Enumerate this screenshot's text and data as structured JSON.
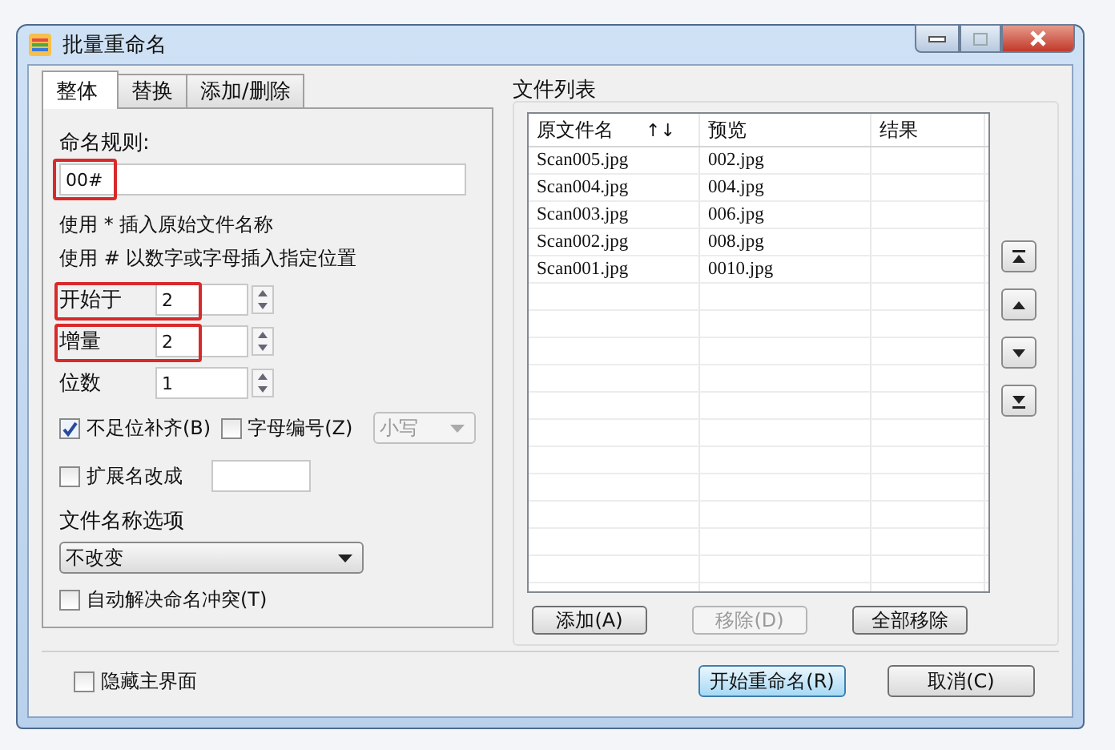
{
  "window": {
    "title": "批量重命名"
  },
  "tabs": [
    {
      "label": "整体",
      "selected": true
    },
    {
      "label": "替换",
      "selected": false
    },
    {
      "label": "添加/删除",
      "selected": false
    }
  ],
  "rule": {
    "label": "命名规则:",
    "value": "00#"
  },
  "hints": [
    "使用 * 插入原始文件名称",
    "使用 # 以数字或字母插入指定位置"
  ],
  "spinners": [
    {
      "label": "开始于",
      "value": "2",
      "highlighted": true
    },
    {
      "label": "增量",
      "value": "2",
      "highlighted": true
    },
    {
      "label": "位数",
      "value": "1",
      "highlighted": false
    }
  ],
  "pad": {
    "label": "不足位补齐(B)",
    "checked": true
  },
  "letters": {
    "label": "字母编号(Z)",
    "checked": false
  },
  "case": {
    "value": "小写",
    "disabled": true
  },
  "extension": {
    "label": "扩展名改成",
    "checked": false
  },
  "name_option": {
    "label": "文件名称选项",
    "value": "不改变"
  },
  "auto_resolve": {
    "label": "自动解决命名冲突(T)",
    "checked": false
  },
  "file_list": {
    "title": "文件列表",
    "columns": [
      "原文件名",
      "预览",
      "结果"
    ],
    "sort_arrows": "↑↓",
    "rows": [
      [
        "Scan005.jpg",
        "002.jpg"
      ],
      [
        "Scan004.jpg",
        "004.jpg"
      ],
      [
        "Scan003.jpg",
        "006.jpg"
      ],
      [
        "Scan002.jpg",
        "008.jpg"
      ],
      [
        "Scan001.jpg",
        "0010.jpg"
      ]
    ]
  },
  "list_buttons": [
    {
      "label": "添加(A)",
      "disabled": false
    },
    {
      "label": "移除(D)",
      "disabled": true
    },
    {
      "label": "全部移除",
      "disabled": false
    }
  ],
  "hide_main": {
    "label": "隐藏主界面",
    "checked": false
  },
  "footer_buttons": [
    {
      "label": "开始重命名(R)",
      "default": true
    },
    {
      "label": "取消(C)",
      "default": false
    }
  ]
}
